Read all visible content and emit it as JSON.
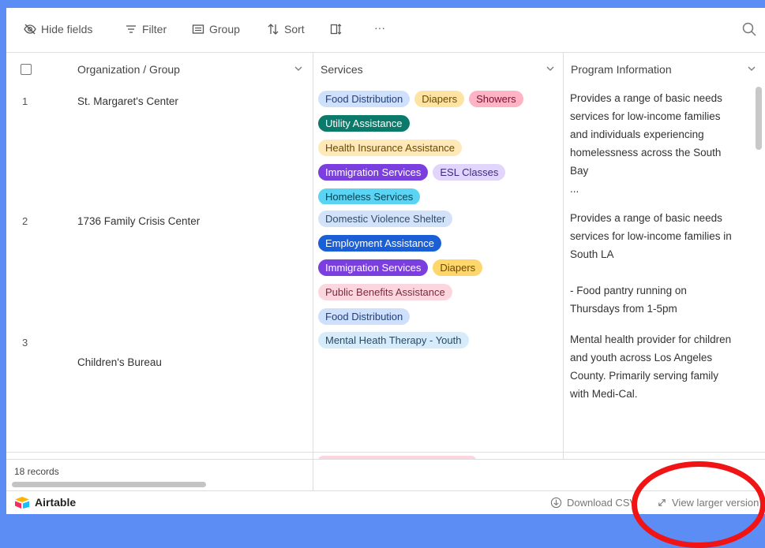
{
  "toolbar": {
    "hide_fields": "Hide fields",
    "filter": "Filter",
    "group": "Group",
    "sort": "Sort",
    "more": "···"
  },
  "columns": {
    "org": "Organization / Group",
    "services": "Services",
    "program": "Program Information"
  },
  "rows": [
    {
      "num": "1",
      "org": "St. Margaret's Center",
      "tags": [
        [
          {
            "label": "Food Distribution",
            "bg": "#cfe0fc",
            "fg": "#1f3f80"
          },
          {
            "label": "Diapers",
            "bg": "#ffe3a3",
            "fg": "#6b4a00"
          },
          {
            "label": "Showers",
            "bg": "#ffb3c4",
            "fg": "#7a1030"
          }
        ],
        [
          {
            "label": "Utility Assistance",
            "bg": "#0b7a6a",
            "fg": "#ffffff"
          }
        ],
        [
          {
            "label": "Health Insurance Assistance",
            "bg": "#ffe9b8",
            "fg": "#6b4a00"
          }
        ],
        [
          {
            "label": "Immigration Services",
            "bg": "#7b3fe0",
            "fg": "#ffffff"
          },
          {
            "label": "ESL Classes",
            "bg": "#e2d5fb",
            "fg": "#3f2a80"
          }
        ],
        [
          {
            "label": "Homeless Services",
            "bg": "#5ad4f2",
            "fg": "#0a3d4d"
          }
        ]
      ],
      "program": [
        "Provides a range of basic needs",
        "services for low-income families",
        "and individuals experiencing",
        "homelessness across the South",
        "Bay",
        "..."
      ]
    },
    {
      "num": "2",
      "org": "1736 Family Crisis Center",
      "tags": [
        [
          {
            "label": "Domestic Violence Shelter",
            "bg": "#d2e2f8",
            "fg": "#304b70"
          }
        ],
        [
          {
            "label": "Employment Assistance",
            "bg": "#1a5fd6",
            "fg": "#ffffff"
          }
        ],
        [
          {
            "label": "Immigration Services",
            "bg": "#7b3fe0",
            "fg": "#ffffff"
          },
          {
            "label": "Diapers",
            "bg": "#ffd66b",
            "fg": "#6b4a00"
          }
        ],
        [
          {
            "label": "Public Benefits Assistance",
            "bg": "#fcd6df",
            "fg": "#7a2a3c"
          }
        ],
        [
          {
            "label": "Food Distribution",
            "bg": "#cfe0fc",
            "fg": "#1f3f80"
          }
        ]
      ],
      "program": [
        "Provides a range of basic needs",
        "services for low-income families in",
        "South LA",
        "",
        "- Food pantry running on",
        "Thursdays from 1-5pm"
      ]
    },
    {
      "num": "3",
      "org": "Children's Bureau",
      "tags": [
        [
          {
            "label": "Mental Heath Therapy - Youth",
            "bg": "#d6ecfb",
            "fg": "#2a4a66"
          }
        ]
      ],
      "program": [
        "Mental health provider for children",
        "and youth across Los Angeles",
        "County. Primarily serving family",
        "with Medi-Cal."
      ]
    }
  ],
  "footer": {
    "records": "18 records",
    "brand": "Airtable",
    "download": "Download CSV",
    "view_larger": "View larger version"
  },
  "colors": {
    "page_bg": "#5b8df5",
    "annotation_red": "#f01414"
  }
}
